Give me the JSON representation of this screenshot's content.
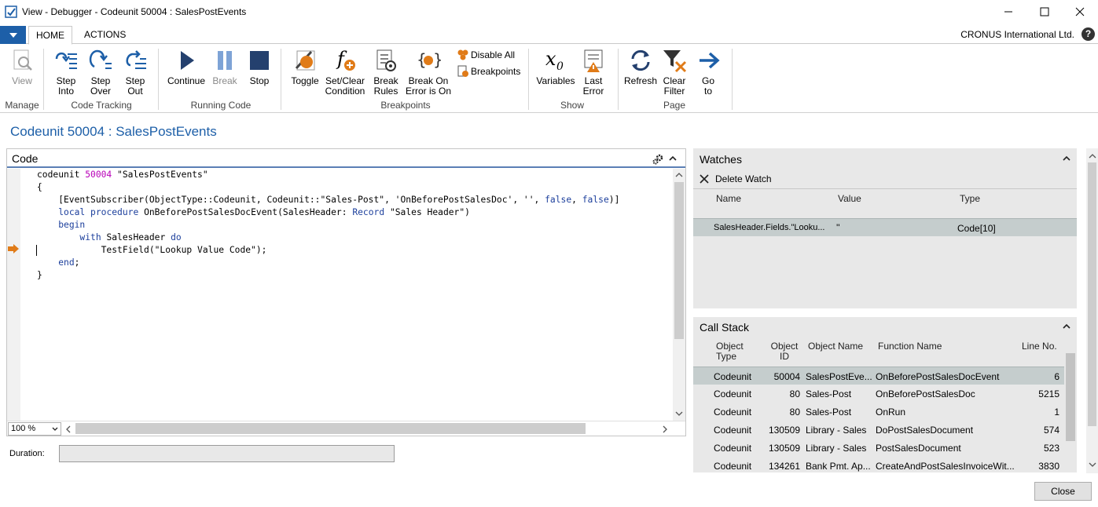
{
  "window": {
    "title": "View - Debugger - Codeunit 50004 : SalesPostEvents"
  },
  "tabs": [
    "HOME",
    "ACTIONS"
  ],
  "company": "CRONUS International Ltd.",
  "help_label": "?",
  "ribbon": {
    "manage": {
      "label": "Manage",
      "view": "View"
    },
    "code_tracking": {
      "label": "Code Tracking",
      "step_into": [
        "Step",
        "Into"
      ],
      "step_over": [
        "Step",
        "Over"
      ],
      "step_out": [
        "Step",
        "Out"
      ]
    },
    "running_code": {
      "label": "Running Code",
      "continue": "Continue",
      "break": "Break",
      "stop": "Stop"
    },
    "breakpoints": {
      "label": "Breakpoints",
      "toggle": "Toggle",
      "set_clear": [
        "Set/Clear",
        "Condition"
      ],
      "break_rules": [
        "Break",
        "Rules"
      ],
      "break_on_error": [
        "Break On",
        "Error is On"
      ],
      "disable_all": "Disable All",
      "breakpoints": "Breakpoints"
    },
    "show": {
      "label": "Show",
      "variables": "Variables",
      "last_error": [
        "Last",
        "Error"
      ]
    },
    "page": {
      "label": "Page",
      "refresh": "Refresh",
      "clear_filter": [
        "Clear",
        "Filter"
      ],
      "go_to": [
        "Go",
        "to"
      ]
    }
  },
  "page_title": "Codeunit 50004 : SalesPostEvents",
  "code_panel": {
    "title": "Code",
    "zoom": "100 %",
    "lines": [
      "codeunit 50004 \"SalesPostEvents\"",
      "{",
      "    [EventSubscriber(ObjectType::Codeunit, Codeunit::\"Sales-Post\", 'OnBeforePostSalesDoc', '', false, false)]",
      "    local procedure OnBeforePostSalesDocEvent(SalesHeader: Record \"Sales Header\")",
      "    begin",
      "        with SalesHeader do",
      "            TestField(\"Lookup Value Code\");",
      "    end;",
      "}"
    ],
    "current_line": 7
  },
  "duration": {
    "label": "Duration:",
    "value": ""
  },
  "watches": {
    "title": "Watches",
    "delete_label": "Delete Watch",
    "columns": [
      "Name",
      "Value",
      "Type"
    ],
    "rows": [
      {
        "name": "SalesHeader.Fields.\"Looku...",
        "value": "''",
        "type": "Code[10]"
      }
    ]
  },
  "call_stack": {
    "title": "Call Stack",
    "columns": [
      "Object Type",
      "Object ID",
      "Object Name",
      "Function Name",
      "Line No."
    ],
    "rows": [
      {
        "object_type": "Codeunit",
        "object_id": "50004",
        "object_name": "SalesPostEve...",
        "function_name": "OnBeforePostSalesDocEvent",
        "line_no": "6"
      },
      {
        "object_type": "Codeunit",
        "object_id": "80",
        "object_name": "Sales-Post",
        "function_name": "OnBeforePostSalesDoc",
        "line_no": "5215"
      },
      {
        "object_type": "Codeunit",
        "object_id": "80",
        "object_name": "Sales-Post",
        "function_name": "OnRun",
        "line_no": "1"
      },
      {
        "object_type": "Codeunit",
        "object_id": "130509",
        "object_name": "Library - Sales",
        "function_name": "DoPostSalesDocument",
        "line_no": "574"
      },
      {
        "object_type": "Codeunit",
        "object_id": "130509",
        "object_name": "Library - Sales",
        "function_name": "PostSalesDocument",
        "line_no": "523"
      },
      {
        "object_type": "Codeunit",
        "object_id": "134261",
        "object_name": "Bank Pmt. Ap...",
        "function_name": "CreateAndPostSalesInvoiceWit...",
        "line_no": "3830"
      }
    ]
  },
  "close_label": "Close",
  "colors": {
    "accent": "#1d5fa8",
    "selected_row": "#c5cdcd",
    "panel_bg": "#e8e8e8",
    "arrow": "#e07b18"
  }
}
